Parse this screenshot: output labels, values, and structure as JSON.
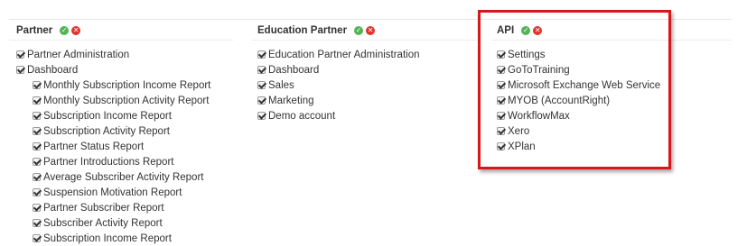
{
  "columns": [
    {
      "title": "Partner",
      "items": [
        {
          "label": "Partner Administration",
          "indent": 0
        },
        {
          "label": "Dashboard",
          "indent": 0
        },
        {
          "label": "Monthly Subscription Income Report",
          "indent": 1
        },
        {
          "label": "Monthly Subscription Activity Report",
          "indent": 1
        },
        {
          "label": "Subscription Income Report",
          "indent": 1
        },
        {
          "label": "Subscription Activity Report",
          "indent": 1
        },
        {
          "label": "Partner Status Report",
          "indent": 1
        },
        {
          "label": "Partner Introductions Report",
          "indent": 1
        },
        {
          "label": "Average Subscriber Activity Report",
          "indent": 1
        },
        {
          "label": "Suspension Motivation Report",
          "indent": 1
        },
        {
          "label": "Partner Subscriber Report",
          "indent": 1
        },
        {
          "label": "Subscriber Activity Report",
          "indent": 1
        },
        {
          "label": "Subscription Income Report",
          "indent": 1
        }
      ]
    },
    {
      "title": "Education Partner",
      "items": [
        {
          "label": "Education Partner Administration",
          "indent": 0
        },
        {
          "label": "Dashboard",
          "indent": 0
        },
        {
          "label": "Sales",
          "indent": 0
        },
        {
          "label": "Marketing",
          "indent": 0
        },
        {
          "label": "Demo account",
          "indent": 0
        }
      ]
    },
    {
      "title": "API",
      "items": [
        {
          "label": "Settings",
          "indent": 0
        },
        {
          "label": "GoToTraining",
          "indent": 0
        },
        {
          "label": "Microsoft Exchange Web Service",
          "indent": 0
        },
        {
          "label": "MYOB (AccountRight)",
          "indent": 0
        },
        {
          "label": "WorkflowMax",
          "indent": 0
        },
        {
          "label": "Xero",
          "indent": 0
        },
        {
          "label": "XPlan",
          "indent": 0
        }
      ]
    }
  ],
  "icons": {
    "select_all": "check-circle-icon",
    "deselect_all": "x-circle-icon"
  },
  "colors": {
    "check_all": "#54b257",
    "clear_all": "#e0332d",
    "highlight_box": "#d71818"
  }
}
